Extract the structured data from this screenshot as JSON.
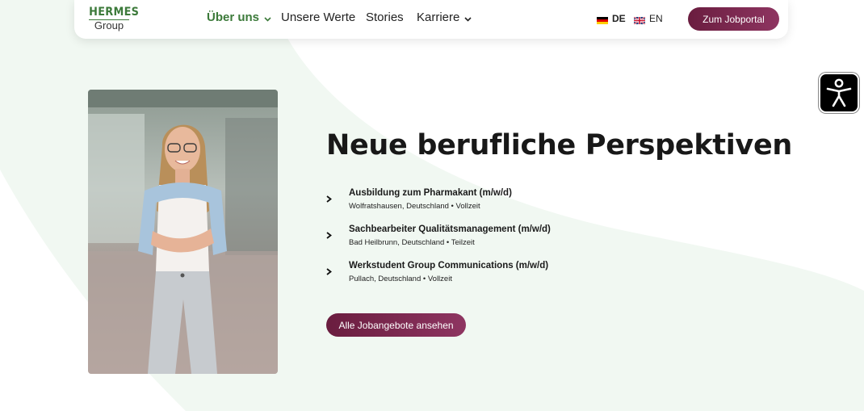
{
  "logo": {
    "top": "HERMES",
    "bottom": "Group"
  },
  "nav": {
    "items": [
      {
        "label": "Über uns",
        "active": true,
        "dropdown": true
      },
      {
        "label": "Unsere Werte"
      },
      {
        "label": "Stories"
      },
      {
        "label": "Karriere",
        "dropdown": true
      }
    ],
    "languages": [
      {
        "code": "DE",
        "active": true,
        "flag": "germany-flag-icon"
      },
      {
        "code": "EN",
        "active": false,
        "flag": "uk-flag-icon"
      }
    ],
    "cta_label": "Zum Jobportal"
  },
  "hero": {
    "headline": "Neue berufliche Perspektiven",
    "jobs": [
      {
        "title": "Ausbildung zum Pharmakant (m/w/d)",
        "meta": "Wolfratshausen, Deutschland • Vollzeit"
      },
      {
        "title": "Sachbearbeiter Qualitätsmanagement (m/w/d)",
        "meta": "Bad Heilbrunn, Deutschland • Teilzeit"
      },
      {
        "title": "Werkstudent Group Communications (m/w/d)",
        "meta": "Pullach, Deutschland • Vollzeit"
      }
    ],
    "cta_label": "Alle Jobangebote ansehen"
  },
  "colors": {
    "brand_green": "#3c7a3a",
    "button_plum": "#7a2850",
    "background_mint": "#f1f8f2"
  },
  "icons": {
    "accessibility": "accessibility-person-icon",
    "chevron": "chevron-down-icon",
    "arrow": "chevron-right-icon"
  }
}
